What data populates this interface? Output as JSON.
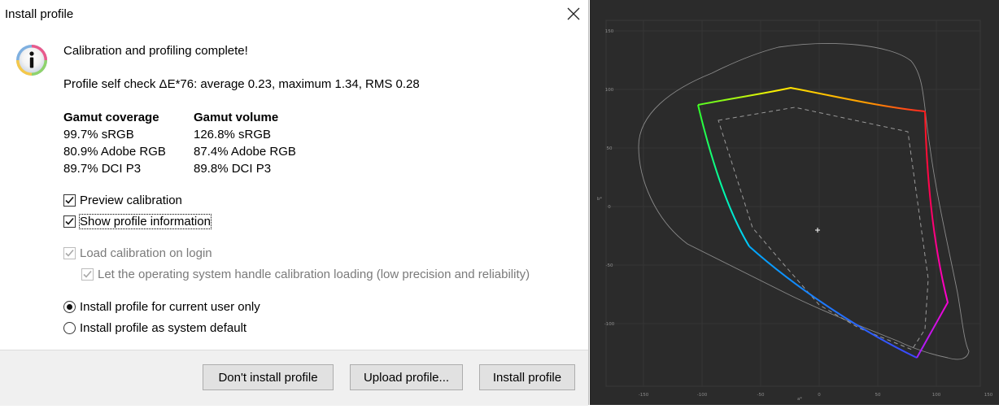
{
  "dialog": {
    "title": "Install profile",
    "heading": "Calibration and profiling complete!",
    "self_check": "Profile self check ΔE*76: average 0.23, maximum 1.34, RMS 0.28",
    "coverage": {
      "header": "Gamut coverage",
      "rows": [
        "99.7% sRGB",
        "80.9% Adobe RGB",
        "89.7% DCI P3"
      ]
    },
    "volume": {
      "header": "Gamut volume",
      "rows": [
        "126.8% sRGB",
        "87.4% Adobe RGB",
        "89.8% DCI P3"
      ]
    },
    "options": {
      "preview_calibration": {
        "label": "Preview calibration",
        "checked": true
      },
      "show_profile_information": {
        "label": "Show profile information",
        "checked": true
      },
      "load_calibration": {
        "label": "Load calibration on login",
        "checked": true,
        "disabled": true
      },
      "os_handle": {
        "label": "Let the operating system handle calibration loading (low precision and reliability)",
        "checked": true,
        "disabled": true
      }
    },
    "install_scope": {
      "current_user": {
        "label": "Install profile for current user only",
        "selected": true
      },
      "system_default": {
        "label": "Install profile as system default",
        "selected": false
      }
    },
    "buttons": {
      "dont_install": "Don't install profile",
      "upload": "Upload profile...",
      "install": "Install profile"
    },
    "icons": {
      "close": "close-icon",
      "info": "info-icon"
    }
  },
  "gamut_plot": {
    "x_ticks": [
      "-150",
      "-100",
      "-50",
      "0",
      "50",
      "100",
      "150"
    ],
    "y_ticks": [
      "150",
      "100",
      "50",
      "0",
      "-50",
      "-100"
    ],
    "xlabel": "a*",
    "ylabel": "b*",
    "colors": {
      "background": "#2b2b2b",
      "grid": "#3a3a3a",
      "reference": "#8a8a8a"
    }
  }
}
